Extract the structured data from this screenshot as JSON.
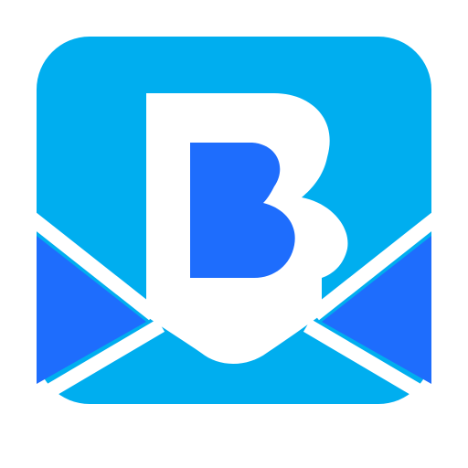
{
  "app_icon": {
    "name": "envelope-b-logo",
    "letter": "B",
    "colors": {
      "background": "#ffffff",
      "tile": "#00aeef",
      "envelope_flap": "#1e6dfd",
      "letter_fill": "#ffffff",
      "letter_counter": "#1e6dfd",
      "envelope_lines": "#ffffff"
    }
  }
}
